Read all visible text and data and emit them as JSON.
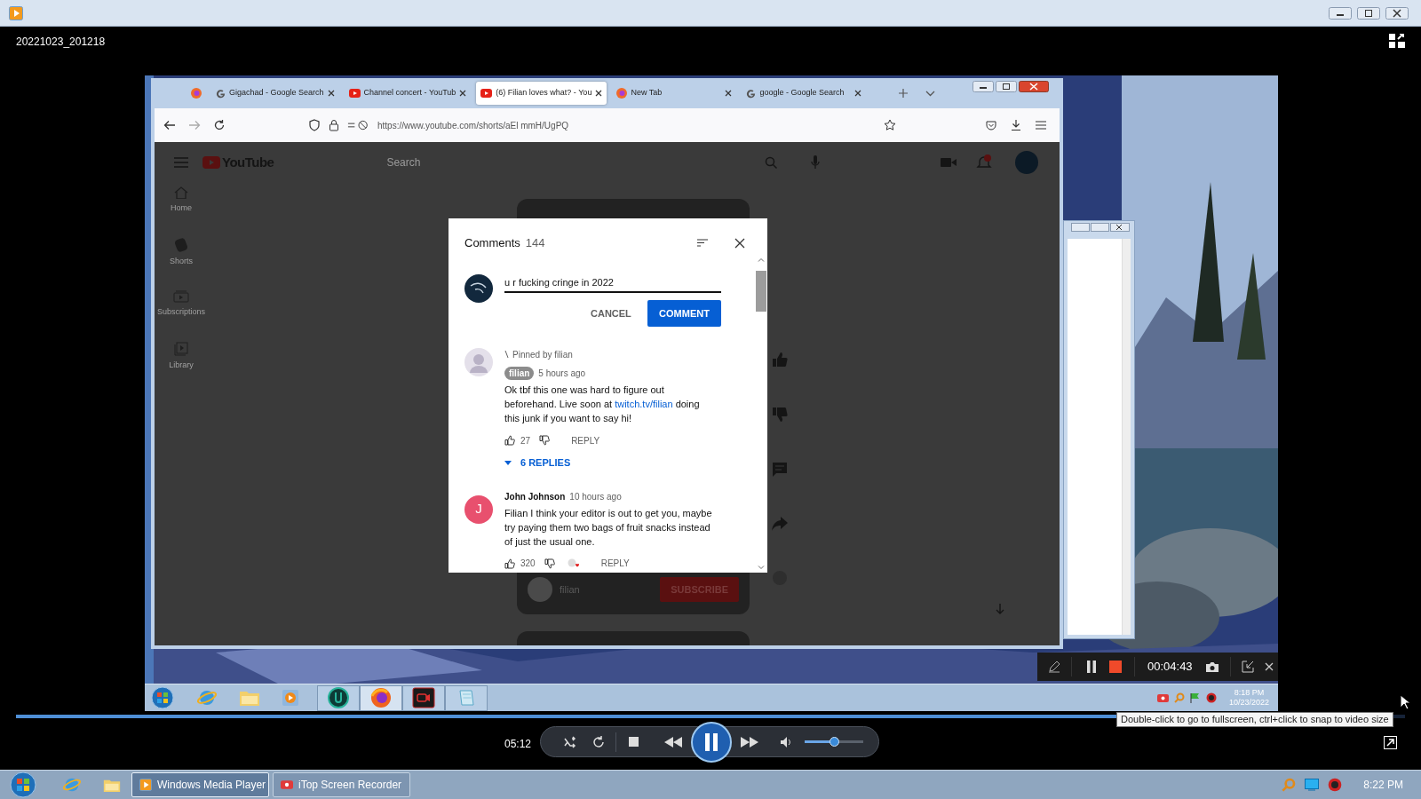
{
  "window": {
    "title": "20221023_201218"
  },
  "recording": {
    "browser": {
      "tabs": [
        {
          "kind": "firefox",
          "selected": false
        },
        {
          "kind": "google",
          "label": "Gigachad - Google Search",
          "selected": false
        },
        {
          "kind": "youtube",
          "label": "Channel concert - YouTub",
          "selected": false
        },
        {
          "kind": "youtube",
          "label": "(6) Filian loves what? - You",
          "selected": true
        },
        {
          "kind": "firefox",
          "label": "New Tab",
          "selected": false
        },
        {
          "kind": "google",
          "label": "google - Google Search",
          "selected": false
        }
      ],
      "url": "https://www.youtube.com/shorts/aEl mmH/UgPQ"
    },
    "youtube": {
      "logo": "YouTube",
      "search_placeholder": "Search",
      "nav": [
        {
          "kind": "home",
          "label": "Home"
        },
        {
          "kind": "shorts",
          "label": "Shorts"
        },
        {
          "kind": "subscriptions",
          "label": "Subscriptions"
        },
        {
          "kind": "library",
          "label": "Library"
        }
      ],
      "channel": "filian",
      "subscribe": "SUBSCRIBE"
    },
    "comments": {
      "title": "Comments",
      "count": "144",
      "draft": "u r fucking cringe in 2022",
      "cancel": "CANCEL",
      "submit": "COMMENT",
      "items": [
        {
          "pinned": "Pinned by filian",
          "kind": "silhouette",
          "author": "filian",
          "author_badge": true,
          "time": "5 hours ago",
          "text": "Ok tbf this one was hard to figure out beforehand. Live soon at ",
          "link": "twitch.tv/filian",
          "text_after": " doing this junk if you want to say hi!",
          "likes": "27",
          "reply": "REPLY",
          "hearted": false,
          "replies": "6 REPLIES"
        },
        {
          "kind": "letter",
          "avatar_letter": "J",
          "color": "#e8506e",
          "author": "John Johnson",
          "author_badge": false,
          "time": "10 hours ago",
          "text": "Filian I think your editor is out to get you, maybe try paying them two bags of fruit snacks instead of just the usual one.",
          "likes": "320",
          "reply": "REPLY",
          "hearted": true
        }
      ]
    },
    "recorder": {
      "elapsed": "00:04:43"
    },
    "taskbar": {
      "time": "8:18 PM",
      "date": "10/23/2022"
    }
  },
  "player": {
    "seek": {
      "level": 0.99
    },
    "position": "05:12",
    "volume": {
      "level": 0.5
    },
    "tooltip": "Double-click to go to fullscreen, ctrl+click to snap to video size"
  },
  "taskbar": {
    "apps": [
      {
        "kind": "wmp",
        "label": "Windows Media Player",
        "selected": true
      },
      {
        "kind": "itop",
        "label": "iTop Screen Recorder",
        "selected": false
      }
    ],
    "time": "8:22 PM"
  }
}
